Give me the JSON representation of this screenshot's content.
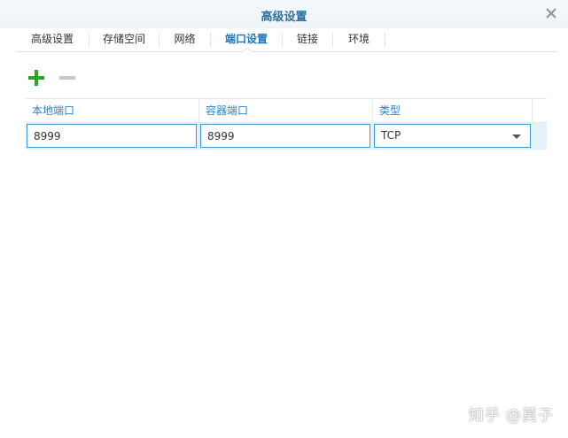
{
  "window": {
    "title": "高级设置",
    "close_icon": "close-icon"
  },
  "tabs": [
    {
      "label": "高级设置",
      "active": false
    },
    {
      "label": "存储空间",
      "active": false
    },
    {
      "label": "网络",
      "active": false
    },
    {
      "label": "端口设置",
      "active": true
    },
    {
      "label": "链接",
      "active": false
    },
    {
      "label": "环境",
      "active": false
    }
  ],
  "toolbar": {
    "add_icon": "plus-icon",
    "remove_icon": "minus-icon",
    "add_color": "#2aa52a",
    "remove_color": "#c8c8c8"
  },
  "grid": {
    "columns": [
      "本地端口",
      "容器端口",
      "类型"
    ],
    "rows": [
      {
        "local_port": "8999",
        "container_port": "8999",
        "type": "TCP"
      }
    ]
  },
  "watermark": "知乎 @莫子",
  "colors": {
    "accent": "#1f76b8",
    "header_text": "#2d82c4",
    "selected_row": "#e4f2fb",
    "input_border": "#3a98d3"
  }
}
